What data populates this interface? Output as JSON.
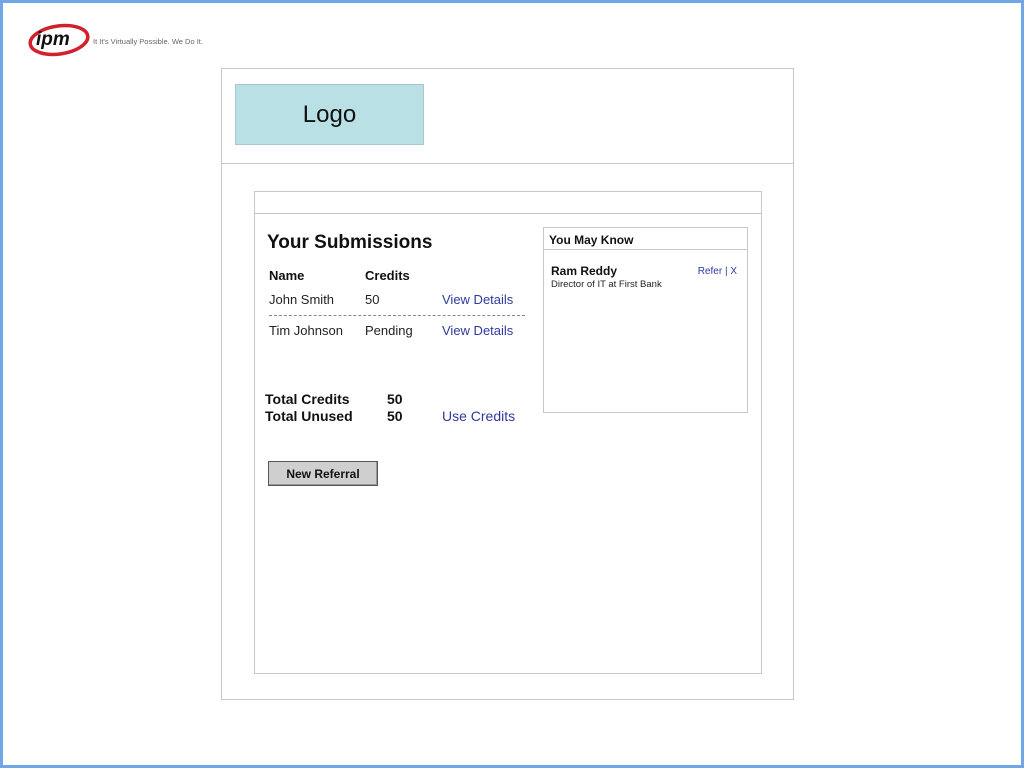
{
  "brand": {
    "name": "ipm",
    "tagline": "It It's Virtually Possible. We Do It.",
    "colors": {
      "red": "#d2202c",
      "link": "#2e3a9e",
      "logo_box": "#b9e0e5",
      "frame": "#6fa8e8"
    }
  },
  "header": {
    "logo_placeholder": "Logo"
  },
  "submissions": {
    "title": "Your Submissions",
    "columns": [
      "Name",
      "Credits"
    ],
    "rows": [
      {
        "name": "John Smith",
        "credits": "50",
        "action": "View Details"
      },
      {
        "name": "Tim Johnson",
        "credits": "Pending",
        "action": "View Details"
      }
    ]
  },
  "totals": {
    "credits_label": "Total Credits",
    "credits_value": "50",
    "unused_label": "Total Unused",
    "unused_value": "50",
    "use_credits_link": "Use Credits"
  },
  "actions": {
    "new_referral": "New Referral"
  },
  "you_may_know": {
    "title": "You May Know",
    "people": [
      {
        "name": "Ram Reddy",
        "title": "Director of IT at First Bank",
        "refer": "Refer",
        "separator": "|",
        "dismiss": "X"
      }
    ]
  }
}
